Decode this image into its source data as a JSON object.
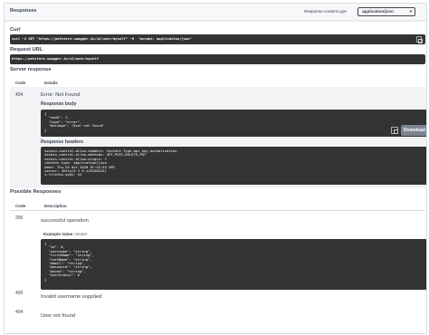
{
  "header": {
    "title": "Responses",
    "content_type_label": "Response content type",
    "content_type_value": "application/json"
  },
  "curl": {
    "label": "Curl",
    "command": "curl -X GET \"https://petstore.swagger.io/v2/user/myself\" -H  \"accept: application/json\""
  },
  "request_url": {
    "label": "Request URL",
    "value": "https://petstore.swagger.io/v2/user/myself"
  },
  "server_response": {
    "label": "Server response",
    "col_code": "Code",
    "col_details": "Details",
    "code": "404",
    "status_text": "Error: Not Found",
    "body_label": "Response body",
    "body": "{\n  \"code\": 1,\n  \"type\": \"error\",\n  \"message\": \"User not found\"\n}",
    "download_label": "Download",
    "headers_label": "Response headers",
    "headers": " access-control-allow-headers: Content-Type,api_key,Authorization \n access-control-allow-methods: GET,POST,DELETE,PUT \n access-control-allow-origin: * \n content-type: application/json \n date: Thu,29 Oct 2020 07:42:53 GMT \n server: Jetty(9.2.9.v20150224) \n x-firefox-spdy: h2 "
  },
  "possible": {
    "label": "Possible Responses",
    "col_code": "Code",
    "col_description": "Description",
    "rows": [
      {
        "code": "200",
        "description": "successful operation"
      },
      {
        "code": "400",
        "description": "Invalid username supplied"
      },
      {
        "code": "404",
        "description": "User not found"
      }
    ],
    "example_value_label": "Example Value",
    "model_label": "Model",
    "example": "{\n  \"id\": 0,\n  \"username\": \"string\",\n  \"firstName\": \"string\",\n  \"lastName\": \"string\",\n  \"email\": \"string\",\n  \"password\": \"string\",\n  \"phone\": \"string\",\n  \"userStatus\": 0\n}"
  }
}
